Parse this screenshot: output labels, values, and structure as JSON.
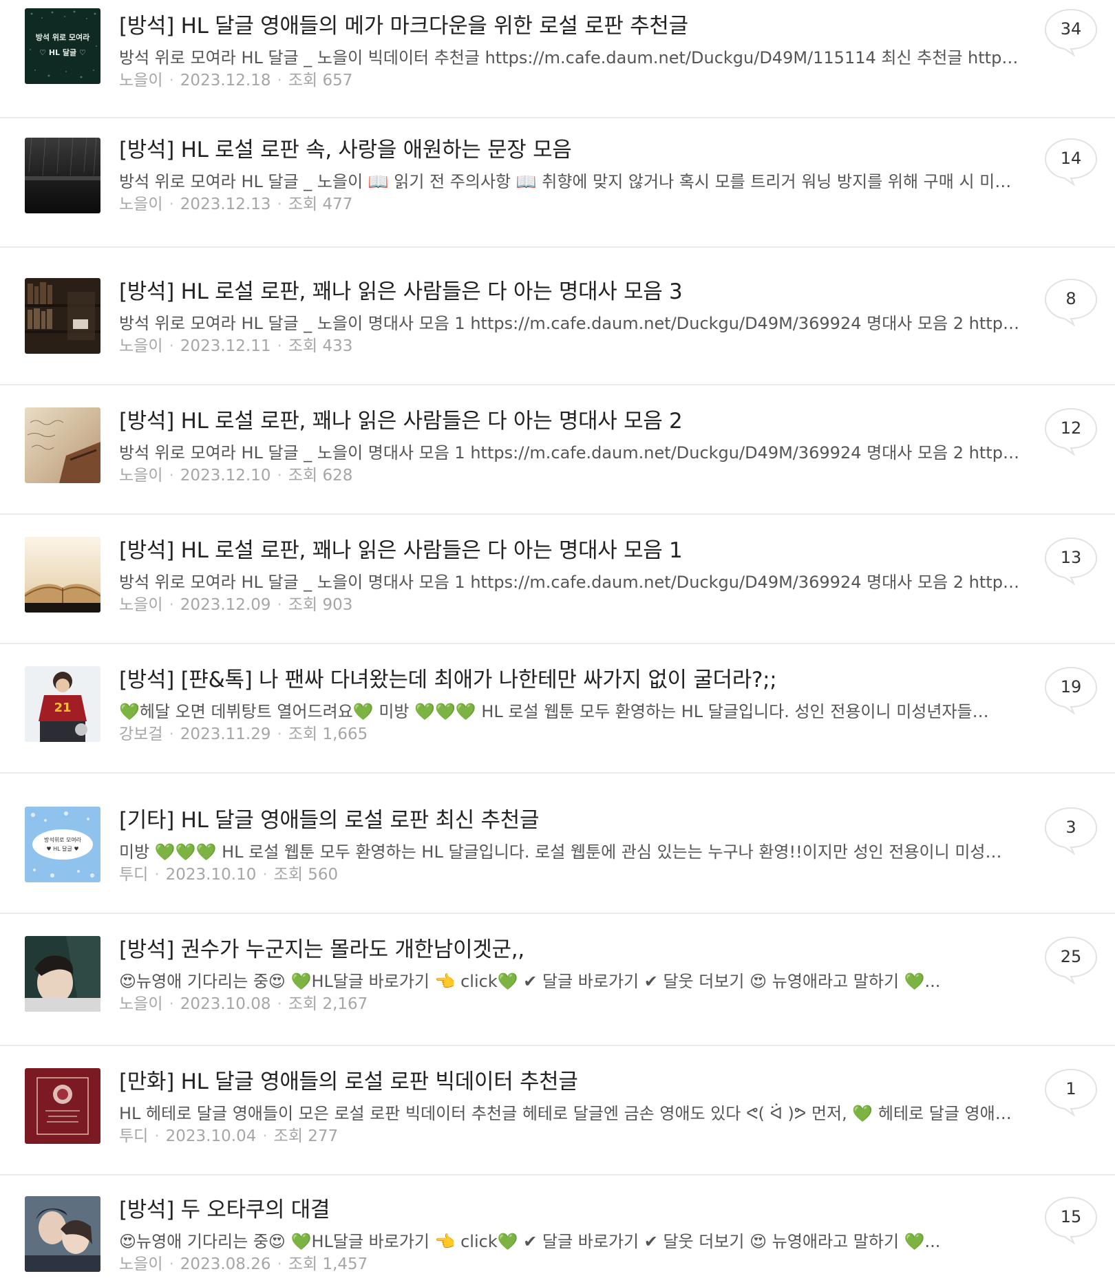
{
  "posts": [
    {
      "title": "[방석] HL 달글 영애들의 메가 마크다운을 위한 로설 로판 추천글",
      "snippet": "방석 위로 모여라 HL 달글 _ 노을이 빅데이터 추천글 https://m.cafe.daum.net/Duckgu/D49M/115114 최신 추천글 https:/...",
      "author": "노을이",
      "date": "2023.12.18",
      "views": "조회 657",
      "comments": "34",
      "thumb_text": [
        "방석 위로 모여라",
        "♡ HL 달글 ♡"
      ]
    },
    {
      "title": "[방석] HL 로설 로판 속, 사랑을 애원하는 문장 모음",
      "snippet": "방석 위로 모여라 HL 달글 _ 노을이 📖 읽기 전 주의사항 📖 취향에 맞지 않거나 혹시 모를 트리거 워닝 방지를 위해 구매 시 미…",
      "author": "노을이",
      "date": "2023.12.13",
      "views": "조회 477",
      "comments": "14"
    },
    {
      "title": "[방석] HL 로설 로판, 꽤나 읽은 사람들은 다 아는 명대사 모음 3",
      "snippet": "방석 위로 모여라 HL 달글 _ 노을이 명대사 모음 1 https://m.cafe.daum.net/Duckgu/D49M/369924 명대사 모음 2 https...",
      "author": "노을이",
      "date": "2023.12.11",
      "views": "조회 433",
      "comments": "8"
    },
    {
      "title": "[방석] HL 로설 로판, 꽤나 읽은 사람들은 다 아는 명대사 모음 2",
      "snippet": "방석 위로 모여라 HL 달글 _ 노을이 명대사 모음 1 https://m.cafe.daum.net/Duckgu/D49M/369924 명대사 모음 2 https...",
      "author": "노을이",
      "date": "2023.12.10",
      "views": "조회 628",
      "comments": "12"
    },
    {
      "title": "[방석] HL 로설 로판, 꽤나 읽은 사람들은 다 아는 명대사 모음 1",
      "snippet": "방석 위로 모여라 HL 달글 _ 노을이 명대사 모음 1 https://m.cafe.daum.net/Duckgu/D49M/369924 명대사 모음 2 https...",
      "author": "노을이",
      "date": "2023.12.09",
      "views": "조회 903",
      "comments": "13"
    },
    {
      "title": "[방석] [퍈&톡] 나 팬싸 다녀왔는데 최애가 나한테만 싸가지 없이 굴더라?;;",
      "snippet": "💚헤달 오면 데뷔탕트 열어드려요💚 미방 💚💚💚 HL 로설 웹툰 모두 환영하는 HL 달글입니다. 성인 전용이니 미성년자들…",
      "author": "강보걸",
      "date": "2023.11.29",
      "views": "조회 1,665",
      "comments": "19"
    },
    {
      "title": "[기타] HL 달글 영애들의 로설 로판 최신 추천글",
      "snippet": "미방 💚💚💚 HL 로설 웹툰 모두 환영하는 HL 달글입니다. 로설 웹툰에 관심 있는는 누구나 환영!!이지만 성인 전용이니 미성…",
      "author": "투디",
      "date": "2023.10.10",
      "views": "조회 560",
      "comments": "3",
      "thumb_text": [
        "방석위로 모여라",
        "♥ HL 달글 ♥"
      ]
    },
    {
      "title": "[방석] 권수가 누군지는 몰라도 개한남이겟군,,",
      "snippet": "😍뉴영애 기다리는 중😍 💚HL달글 바로가기 👈 click💚 ✔ 달글 바로가기 ✔ 달웃 더보기 😍 뉴영애라고 말하기 💚...",
      "author": "노을이",
      "date": "2023.10.08",
      "views": "조회 2,167",
      "comments": "25"
    },
    {
      "title": "[만화] HL 달글 영애들의 로설 로판 빅데이터 추천글",
      "snippet": "HL 헤테로 달글 영애들이 모은 로설 로판 빅데이터 추천글 헤테로 달글엔 금손 영애도 있다 ᕙ( ᐛ )ᕗ 먼저, 💚 헤테로 달글 영애…",
      "author": "투디",
      "date": "2023.10.04",
      "views": "조회 277",
      "comments": "1"
    },
    {
      "title": "[방석] 두 오타쿠의 대결",
      "snippet": "😍뉴영애 기다리는 중😍 💚HL달글 바로가기 👈 click💚 ✔ 달글 바로가기 ✔ 달웃 더보기 😍 뉴영애라고 말하기 💚...",
      "author": "노을이",
      "date": "2023.08.26",
      "views": "조회 1,457",
      "comments": "15"
    }
  ]
}
